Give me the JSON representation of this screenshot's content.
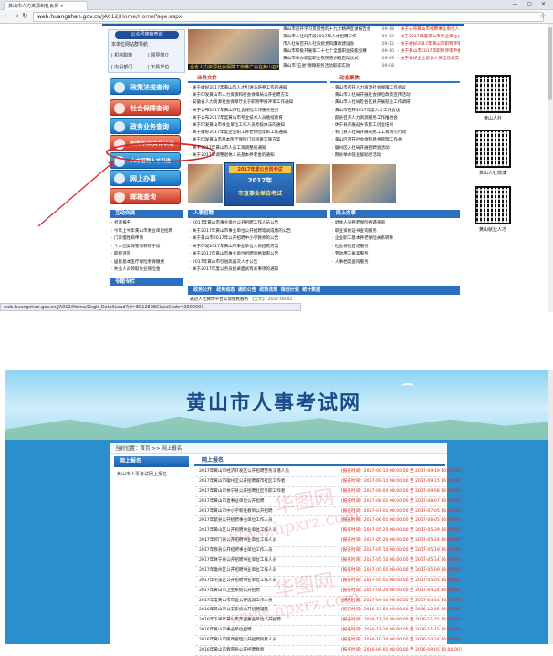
{
  "browser": {
    "tab_title": "黄山市人力资源和社会保 ×",
    "url_host": "web.huangshan.gov.cn",
    "url_path": "/JA012/Home/HomePage.aspx",
    "status_url": "web.huangshan.gov.cn/JA012/Home/Zxgk_DetailLoad?id=8912808ClassCode=2902001"
  },
  "sidebar": {
    "search_btn": "公众号搜索查询",
    "notice": "本单位网站群导航",
    "links": [
      "| 机构职能",
      "| 领导简介",
      "| 内设部门",
      "| 下属单位"
    ],
    "categories": [
      "政策法规查询",
      "社会保障查询",
      "政务业务查询",
      "职称职业资格认证",
      "人才招聘人才引进",
      "网上办事",
      "邮箱查询"
    ]
  },
  "top_photo_caption": "全省人力资源社会保障工作推广会在黄山召开",
  "top_news": [
    {
      "t": "黄山市召开学习贯彻党的十九大精神宣讲报告会",
      "d": "09-18"
    },
    {
      "t": "黄山市人社局开展2017年人才招聘工作",
      "d": "09-13"
    },
    {
      "t": "市人社局召开人社系统党风廉政建设会",
      "d": "09-12"
    },
    {
      "t": "黄山市积极开展第二十七个全国职业技能竞赛",
      "d": "09-10"
    },
    {
      "t": "黄山市举办新型职业农民培训班启动仪式",
      "d": "09-09"
    },
    {
      "t": "黄山市\"五进\"保障服务活动取得实效",
      "d": "09-08"
    }
  ],
  "right_news": [
    "· 关于公布黄山市招聘事业单位人员名单",
    "· 关于2017年度黄山市事业单位公开",
    "· 关于做好2017年黄山市职称评审工作",
    "· 关于黄山市2017年职称评审申报",
    "· 关于做好企业退休人员信息核实"
  ],
  "section_headings": {
    "policy": "业务文件",
    "news": "动态聚焦",
    "recruit": "人事招聘",
    "service": "网上办事",
    "interact": "互动交流",
    "special": "专题专栏",
    "public": "政务公开"
  },
  "policy_list": [
    "· 关于做好2017年黄山市人才引进与培养工作的通知",
    "· 关于印发黄山市人力资源和社会保障局公开招聘方案",
    "· 安徽省人力资源社会保障厅关于职称申报评审工作通知",
    "· 关于公布2017年黄山市社会保险工作重点任务",
    "· 关于公布2017年度黄山市专业技术人员继续教育",
    "· 关于印发黄山市事业单位工作人员考核办法的通知",
    "· 关于做好2017年度企业职工养老保险年审工作通知",
    "· 关于印发黄山市基本医疗保险门诊统筹实施方案",
    "· 关于2017年黄山市人员工资调整的通知",
    "· 关于2017年调整退休人员基本养老金的通知"
  ],
  "focus_list": [
    "· 黄山市召开人力资源社会保障工作会议",
    "· 黄山市人社局开展社会保险政策宣传活动",
    "· 黄山市人社局赴各区县开展就业工作调研",
    "· 黄山市召开2017年度人才工作会议",
    "· 歙县召开人力资源服务工作推进会",
    "· 休宁县开展返乡农民工创业培训",
    "· 祁门县人社局开展农民工工资清欠行动",
    "· 黄山区召开社会保险基金管理工作会",
    "· 徽州区人社局开展招聘会活动",
    "· 黟县举办就业援助月活动"
  ],
  "exam_banner": {
    "tag": "2017年度公务员考试",
    "title": "公务员考试",
    "year": "2017年",
    "sub": "市直事业单位考试"
  },
  "interact_list": [
    "· 考试报名",
    "· 今年上半年黄山市事业单位招聘",
    "· 门诊慢性病申请",
    "· 个人档案保管与转移手续",
    "· 职称评审",
    "· 居民基本医疗保险参保缴费",
    "· 失业人员领取失业保险金"
  ],
  "recruit_list": [
    "· 2017年黄山市事业单位公开招聘工作人员公告",
    "· 关于2017年黄山市事业单位公开招聘笔试成绩的公告",
    "· 关于黄山市2017年公开招聘中小学教师的公告",
    "· 关于印发2017年黄山市事业单位人员招聘方案",
    "· 关于2017年黄山市事业单位招聘资格复审公告",
    "· 2017年黄山市引进高层次人才公告",
    "· 关于2017年度公务员招录面试有关事项的通知"
  ],
  "service_list": [
    "· 退休人员养老保险待遇查询",
    "· 职业资格证书查询服务",
    "· 企业职工基本养老保险关系转移",
    "· 社会保险登记服务",
    "· 劳动用工备案服务",
    "· 人事档案查询服务"
  ],
  "qr_labels": [
    "黄山人社",
    "黄山人社微博",
    "黄山就业人才"
  ],
  "public_bar": {
    "tabs": [
      "政务动态",
      "通知公告",
      "政策法规",
      "规划计划",
      "统计数据"
    ],
    "item": "通过人社微博平台实现便民服务",
    "more": "【全文】",
    "date": "2017-09-02"
  },
  "site2": {
    "title": "黄山市人事考试网",
    "crumb": "当前位置：首页 >> 网上报名",
    "left_head": "网上报名",
    "left_item": "黄山市人事考试网上报名",
    "right_head": "网上报名",
    "watermark": [
      "华图网",
      "www.hpxrz.com"
    ],
    "rows": [
      {
        "t": "2017年黄山市经济开发区公开招聘劳务派遣人员",
        "d": "[报名时间：2017-09-13 08:00:00 至 2017-09-19 16:00:00]"
      },
      {
        "t": "2017年黄山市徽州区公开招聘城市社区工作者",
        "d": "[报名时间：2017-09-11 08:00:00 至 2017-09-15 16:00:00]"
      },
      {
        "t": "2017年黄山市休宁县公开招聘社区专职工作者",
        "d": "[报名时间：2017-09-04 08:00:00 至 2017-09-08 16:00:00]"
      },
      {
        "t": "2017年黄山市直事业单位公开招聘",
        "d": "[报名时间：2017-08-01 08:00:00 至 2017-08-07 16:00:00]"
      },
      {
        "t": "2017年黄山市中小学新任教师公开招聘",
        "d": "[报名时间：2017-07-01 08:00:00 至 2017-07-05 16:00:00]"
      },
      {
        "t": "2017年歙县公开招聘事业单位工作人员",
        "d": "[报名时间：2017-06-01 08:00:00 至 2017-06-05 16:00:00]"
      },
      {
        "t": "2017年黄山区公开招聘事业单位工作人员",
        "d": "[报名时间：2017-05-25 08:00:00 至 2017-05-29 16:00:00]"
      },
      {
        "t": "2017年祁门县公开招聘事业单位工作人员",
        "d": "[报名时间：2017-05-20 08:00:00 至 2017-05-24 16:00:00]"
      },
      {
        "t": "2017年黟县公开招聘事业单位工作人员",
        "d": "[报名时间：2017-05-15 08:00:00 至 2017-05-19 16:00:00]"
      },
      {
        "t": "2017年休宁县公开招聘事业单位工作人员",
        "d": "[报名时间：2017-05-10 08:00:00 至 2017-05-14 16:00:00]"
      },
      {
        "t": "2017年徽州区公开招聘事业单位工作人员",
        "d": "[报名时间：2017-05-05 08:00:00 至 2017-05-09 16:00:00]"
      },
      {
        "t": "2017年屯溪区公开招聘事业单位工作人员",
        "d": "[报名时间：2017-05-01 08:00:00 至 2017-05-05 16:00:00]"
      },
      {
        "t": "2017年黄山市卫生系统公开招聘",
        "d": "[报名时间：2017-04-20 08:00:00 至 2017-04-24 16:00:00]"
      },
      {
        "t": "2017年度黄山市市直公开选调工作人员",
        "d": "[报名时间：2017-04-10 08:00:00 至 2017-04-14 16:00:00]"
      },
      {
        "t": "2016年黄山市公安系统公开招聘辅警",
        "d": "[报名时间：2016-12-01 08:00:00 至 2016-12-05 16:00:00]"
      },
      {
        "t": "2016年下半年黄山市市直事业单位公开招聘",
        "d": "[报名时间：2016-11-20 08:00:00 至 2016-11-25 16:00:00]"
      },
      {
        "t": "2016年黄山市事业单位招聘",
        "d": "[报名时间：2016-11-10 08:00:00 至 2016-11-15 16:00:00]"
      },
      {
        "t": "2016年黄山市民政管理公开招聘殡葬人员",
        "d": "[报名时间：2016-10-20 08:00:00 至 2016-10-24 16:00:00]"
      },
      {
        "t": "2016年黄山市教育局公开招聘教师",
        "d": "[报名时间：2016-09-01 08:00:00 至 2016-09-05 16:00:00]"
      }
    ]
  },
  "colors": {
    "accent": "#2b8fce",
    "title": "#1b4c8a",
    "date_red": "#d12b1e",
    "highlight": "#d8262c"
  }
}
